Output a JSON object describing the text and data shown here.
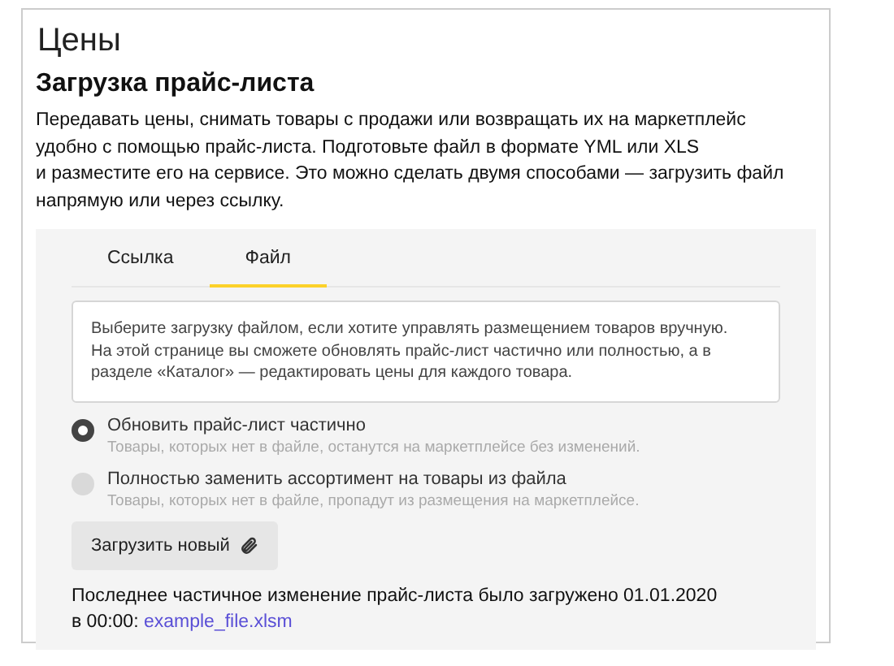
{
  "page_title": "Цены",
  "section_title": "Загрузка прайс-листа",
  "description": "Передавать цены, снимать товары с продажи или возвращать их на маркетплейс\nудобно с помощью прайс-листа. Подготовьте файл в формате YML или XLS\nи разместите его на сервисе. Это можно сделать двумя способами — загрузить файл\nнапрямую или через ссылку.",
  "tabs": [
    {
      "label": "Ссылка",
      "selected": false
    },
    {
      "label": "Файл",
      "selected": true
    }
  ],
  "info": "Выберите загрузку файлом, если хотите управлять размещением товаров вручную.\nНа этой странице вы сможете обновлять прайс-лист частично или полностью, а в\nразделе «Каталог» — редактировать цены для каждого товара.",
  "options": [
    {
      "label": "Обновить прайс-лист частично",
      "hint": "Товары, которых нет в файле, останутся на маркетплейсе без изменений.",
      "selected": true
    },
    {
      "label": "Полностью заменить ассортимент на товары из файла",
      "hint": "Товары, которых нет в файле, пропадут из размещения на маркетплейсе.",
      "selected": false
    }
  ],
  "upload_button": "Загрузить новый",
  "last_change": {
    "text": "Последнее частичное изменение прайс-листа было загружено 01.01.2020\nв 00:00: ",
    "link": "example_file.xlsm"
  }
}
